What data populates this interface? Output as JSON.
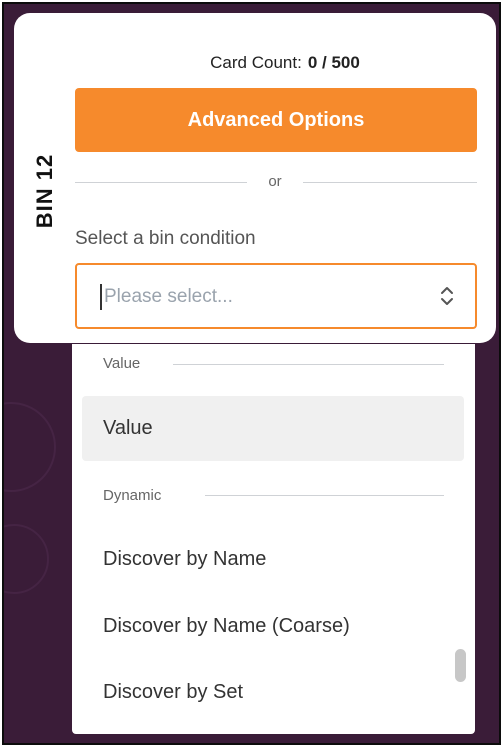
{
  "bin": {
    "label": "BIN 12"
  },
  "card_count": {
    "label": "Card Count:",
    "value": "0 / 500"
  },
  "advanced_button": {
    "label": "Advanced Options"
  },
  "or_divider": {
    "text": "or"
  },
  "condition": {
    "label": "Select a bin condition",
    "placeholder": "Please select..."
  },
  "dropdown": {
    "groups": [
      {
        "label": "Value",
        "options": [
          {
            "label": "Value",
            "highlighted": true
          }
        ]
      },
      {
        "label": "Dynamic",
        "options": [
          {
            "label": "Discover by Name"
          },
          {
            "label": "Discover by Name (Coarse)"
          },
          {
            "label": "Discover by Set"
          }
        ]
      }
    ]
  },
  "colors": {
    "accent": "#f68a2c",
    "background": "#3a1c38",
    "option_highlight": "#f0f0f0"
  },
  "icons": {
    "select_chevron": "chevron-up-down-icon"
  }
}
